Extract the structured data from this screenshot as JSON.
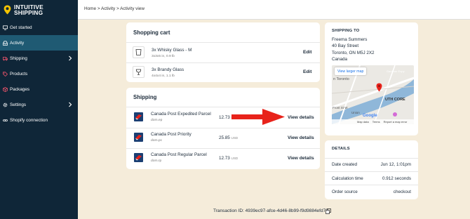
{
  "brand": {
    "name_line1": "INTUITIVE",
    "name_line2": "SHIPPING"
  },
  "sidebar": {
    "items": [
      {
        "label": "Get started",
        "icon": "monitor-icon"
      },
      {
        "label": "Activity",
        "icon": "inbox-icon",
        "active": true
      },
      {
        "label": "Shipping",
        "icon": "truck-icon",
        "expandable": true
      },
      {
        "label": "Products",
        "icon": "tag-icon"
      },
      {
        "label": "Packages",
        "icon": "box-icon"
      },
      {
        "label": "Settings",
        "icon": "gear-icon",
        "expandable": true
      },
      {
        "label": "Shopify connection",
        "icon": "link-icon"
      }
    ]
  },
  "breadcrumb": "Home > Activity > Activity view",
  "cart": {
    "title": "Shopping cart",
    "edit_label": "Edit",
    "items": [
      {
        "name": "3x Whisky Glass - M",
        "dims": "3x3x5 in, 0.9 lb"
      },
      {
        "name": "3x Brandy Glass",
        "dims": "4x4x4 in, 1.1 lb"
      }
    ]
  },
  "shipping": {
    "title": "Shipping",
    "view_label": "View details",
    "rates": [
      {
        "name": "Canada Post Expedited Parcel",
        "code": "dom.ep",
        "price": "12.73",
        "currency": "USD"
      },
      {
        "name": "Canada Post Priority",
        "code": "dom.pc",
        "price": "25.85",
        "currency": "USD"
      },
      {
        "name": "Canada Post Regular Parcel",
        "code": "dom.rp",
        "price": "12.73",
        "currency": "USD"
      }
    ]
  },
  "ship_to": {
    "label": "SHIPPING TO",
    "name": "Freema Summers",
    "street": "40 Bay Street",
    "city": "Toronto, ON M5J 2X2",
    "country": "Canada",
    "map": {
      "button": "View larger map",
      "labels": [
        "n Toronto",
        "UTH CORE",
        "Front St W",
        "Union",
        "Gardiner Expy"
      ],
      "footer": [
        "Map data",
        "Terms",
        "Report a map error"
      ],
      "google": "Google"
    }
  },
  "details": {
    "label": "DETAILS",
    "rows": [
      {
        "label": "Date created",
        "value": "Jun 12, 1:01pm"
      },
      {
        "label": "Calculation time",
        "value": "0.912 seconds"
      },
      {
        "label": "Order source",
        "value": "checkout"
      }
    ]
  },
  "transaction": "Transaction ID: 4939ec97-afce-4d46-8b99-f9d9884efd70",
  "colors": {
    "sidebar": "#0f2638",
    "active": "#1f5a73",
    "accent": "#f5c400",
    "arrow": "#e8231b",
    "background": "#f5ecda"
  }
}
